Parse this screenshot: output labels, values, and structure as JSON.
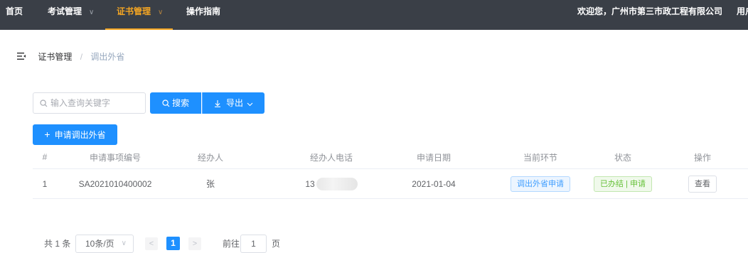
{
  "nav": {
    "home": "首页",
    "exam": "考试管理",
    "cert": "证书管理",
    "guide": "操作指南",
    "welcome": "欢迎您，广州市第三市政工程有限公司",
    "user": "用户"
  },
  "breadcrumb": {
    "parent": "证书管理",
    "separator": "/",
    "current": "调出外省"
  },
  "search": {
    "placeholder": "输入查询关键字",
    "search_label": "搜索",
    "export_label": "导出"
  },
  "apply_button": "申请调出外省",
  "table": {
    "headers": [
      "#",
      "申请事项编号",
      "经办人",
      "经办人电话",
      "申请日期",
      "当前环节",
      "状态",
      "操作"
    ],
    "rows": [
      {
        "index": "1",
        "code": "SA2021010400002",
        "handler": "张",
        "phone": "13",
        "date": "2021-01-04",
        "stage": "调出外省申请",
        "status": "已办结 | 申请",
        "action": "查看"
      }
    ]
  },
  "pagination": {
    "total": "共 1 条",
    "page_size": "10条/页",
    "current_page": "1",
    "goto_label": "前往",
    "goto_value": "1",
    "page_unit": "页"
  },
  "colors": {
    "topbar": "#3a3f47",
    "active_nav": "#f5a623",
    "primary": "#1e90ff"
  }
}
